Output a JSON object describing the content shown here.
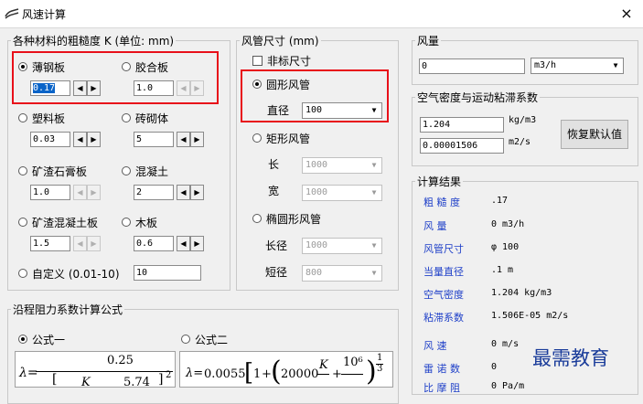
{
  "window": {
    "title": "风速计算",
    "close": "×"
  },
  "roughness": {
    "legend": "各种材料的粗糙度 K  (单位: mm)",
    "materials": [
      {
        "label": "薄钢板",
        "value": "0.17",
        "selected": true
      },
      {
        "label": "胶合板",
        "value": "1.0"
      },
      {
        "label": "塑料板",
        "value": "0.03"
      },
      {
        "label": "砖砌体",
        "value": "5"
      },
      {
        "label": "矿渣石膏板",
        "value": "1.0"
      },
      {
        "label": "混凝土",
        "value": "2"
      },
      {
        "label": "矿渣混凝土板",
        "value": "1.5"
      },
      {
        "label": "木板",
        "value": "0.6"
      }
    ],
    "custom": {
      "label": "自定义 (0.01-10)",
      "value": "10"
    }
  },
  "duct": {
    "legend": "风管尺寸 (mm)",
    "nonstandard": "非标尺寸",
    "round": {
      "label": "圆形风管",
      "diameter_label": "直径",
      "diameter": "100"
    },
    "rect": {
      "label": "矩形风管",
      "length_label": "长",
      "length": "1000",
      "width_label": "宽",
      "width": "1000"
    },
    "oval": {
      "label": "椭圆形风管",
      "major_label": "长径",
      "major": "1000",
      "minor_label": "短径",
      "minor": "800"
    }
  },
  "airflow": {
    "legend": "风量",
    "value": "0",
    "unit": "m3/h"
  },
  "air": {
    "legend": "空气密度与运动粘滞系数",
    "density": "1.204",
    "density_unit": "kg/m3",
    "viscosity": "0.00001506",
    "viscosity_unit": "m2/s",
    "reset_button": "恢复默认值"
  },
  "results": {
    "legend": "计算结果",
    "rows": [
      {
        "label": "粗 糙 度",
        "value": ".17"
      },
      {
        "label": "风    量",
        "value": "0 m3/h"
      },
      {
        "label": "风管尺寸",
        "value": "φ 100"
      },
      {
        "label": "当量直径",
        "value": ".1 m"
      },
      {
        "label": "空气密度",
        "value": "1.204 kg/m3"
      },
      {
        "label": "粘滞系数",
        "value": "1.506E-05 m2/s"
      },
      {
        "label": "风    速",
        "value": "0 m/s"
      },
      {
        "label": "雷 诺 数",
        "value": "0"
      },
      {
        "label": "比 摩 阻",
        "value": "0 Pa/m"
      }
    ]
  },
  "friction": {
    "legend": "沿程阻力系数计算公式",
    "formula1": "公式一",
    "formula2": "公式二",
    "f1_num": "0.25",
    "f2_coef": "0.0055",
    "f2_k": "20000",
    "f2_exp": "10⁶",
    "f2_one": "1"
  },
  "watermark": "最需教育"
}
